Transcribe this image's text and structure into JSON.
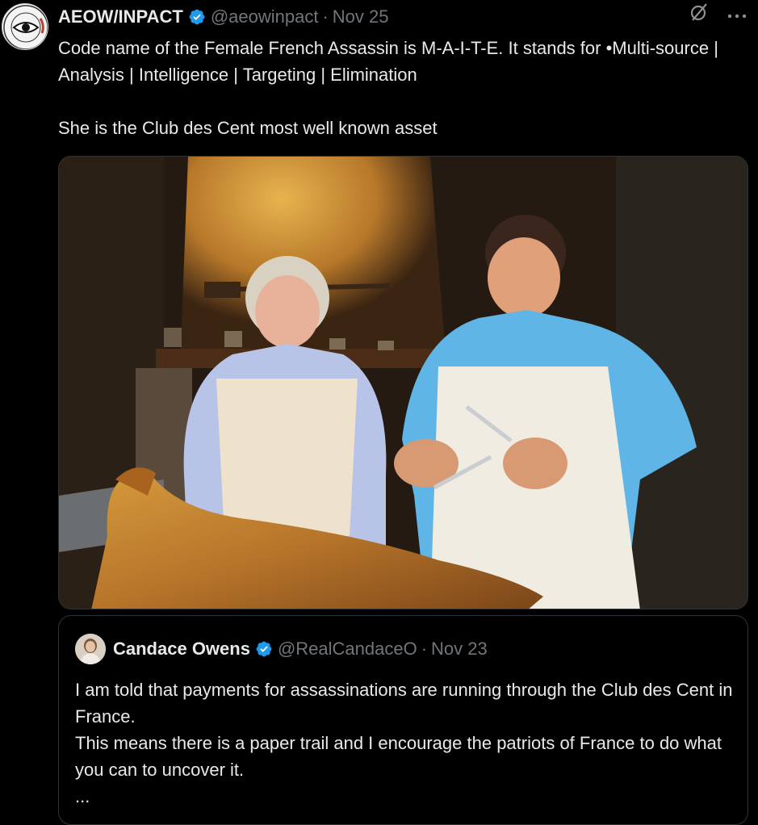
{
  "tweet": {
    "author_name": "AEOW/INPACT",
    "handle": "@aeowinpact",
    "separator": "·",
    "date": "Nov 25",
    "avatar_icon": "eye-seal-logo-icon",
    "avatar_logo_text": "INVESTIGATIONS WITH IMPACT",
    "paragraphs": [
      "Code name of the Female French Assassin is M-A-I-T-E. It stands for •Multi-source | Analysis | Intelligence | Targeting | Elimination",
      "She is the Club des Cent most well known asset"
    ],
    "more_icon": "ellipsis-icon",
    "grok_icon": "slashed-circle-icon",
    "media_alt": "Photo of two women in aprons standing behind a roasted lamb, one holding knives"
  },
  "quote": {
    "author_name": "Candace Owens",
    "handle": "@RealCandaceO",
    "separator": "·",
    "date": "Nov 23",
    "lines": [
      "I am told that payments for assassinations are running through the Club des Cent in France.",
      "This means there is a paper trail and I encourage the patriots of France to do what you can to uncover it.",
      "..."
    ]
  },
  "colors": {
    "background": "#000000",
    "text": "#e7e9ea",
    "muted": "#71767b",
    "verified": "#1d9bf0",
    "border": "#2f3336"
  }
}
